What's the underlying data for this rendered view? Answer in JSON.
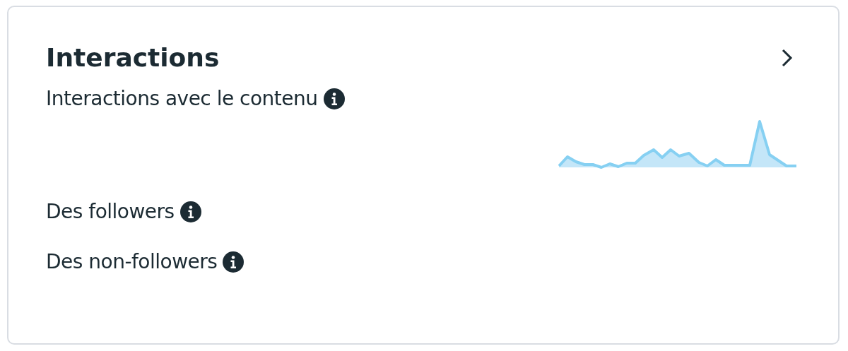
{
  "card": {
    "title": "Interactions",
    "metrics": [
      {
        "label": "Interactions avec le contenu",
        "kind": "sparkline"
      },
      {
        "label": "Des followers",
        "kind": "plain"
      },
      {
        "label": "Des non-followers",
        "kind": "plain"
      }
    ]
  }
}
